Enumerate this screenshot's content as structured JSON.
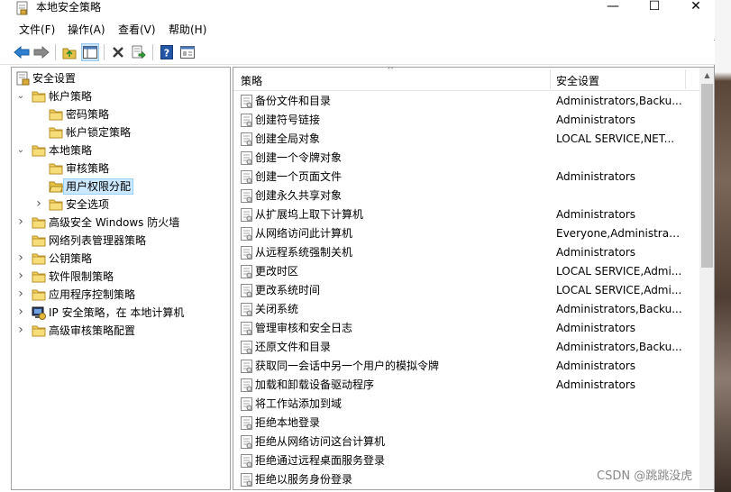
{
  "window": {
    "title": "本地安全策略",
    "minimize_glyph": "—",
    "maximize_glyph": "☐",
    "close_glyph": "✕"
  },
  "menu": [
    "文件(F)",
    "操作(A)",
    "查看(V)",
    "帮助(H)"
  ],
  "toolbar": {
    "buttons": [
      "back-arrow-icon",
      "forward-arrow-icon",
      "up-folder-icon",
      "show-hide-tree-icon",
      "delete-icon",
      "export-list-icon",
      "help-icon",
      "properties-icon"
    ]
  },
  "tree": {
    "items": [
      {
        "label": "安全设置",
        "level": 0,
        "expander": "",
        "icon": "security-settings-icon"
      },
      {
        "label": "帐户策略",
        "level": 1,
        "expander": "expanded",
        "icon": "folder-icon"
      },
      {
        "label": "密码策略",
        "level": 2,
        "expander": "",
        "icon": "folder-icon"
      },
      {
        "label": "帐户锁定策略",
        "level": 2,
        "expander": "",
        "icon": "folder-icon"
      },
      {
        "label": "本地策略",
        "level": 1,
        "expander": "expanded",
        "icon": "folder-icon"
      },
      {
        "label": "审核策略",
        "level": 2,
        "expander": "",
        "icon": "folder-icon"
      },
      {
        "label": "用户权限分配",
        "level": 2,
        "expander": "",
        "icon": "open-folder-icon",
        "selected": true
      },
      {
        "label": "安全选项",
        "level": 2,
        "expander": "collapsed",
        "icon": "folder-icon"
      },
      {
        "label": "高级安全 Windows 防火墙",
        "level": 1,
        "expander": "collapsed",
        "icon": "folder-icon"
      },
      {
        "label": "网络列表管理器策略",
        "level": 1,
        "expander": "",
        "icon": "folder-icon"
      },
      {
        "label": "公钥策略",
        "level": 1,
        "expander": "collapsed",
        "icon": "folder-icon"
      },
      {
        "label": "软件限制策略",
        "level": 1,
        "expander": "collapsed",
        "icon": "folder-icon"
      },
      {
        "label": "应用程序控制策略",
        "level": 1,
        "expander": "collapsed",
        "icon": "folder-icon"
      },
      {
        "label": "IP 安全策略，在 本地计算机",
        "level": 1,
        "expander": "collapsed",
        "icon": "ip-security-icon"
      },
      {
        "label": "高级审核策略配置",
        "level": 1,
        "expander": "collapsed",
        "icon": "folder-icon"
      }
    ]
  },
  "list": {
    "columns": [
      "策略",
      "安全设置"
    ],
    "sort_glyph": "^",
    "rows": [
      {
        "policy": "备份文件和目录",
        "setting": "Administrators,Backu..."
      },
      {
        "policy": "创建符号链接",
        "setting": "Administrators"
      },
      {
        "policy": "创建全局对象",
        "setting": "LOCAL SERVICE,NET..."
      },
      {
        "policy": "创建一个令牌对象",
        "setting": ""
      },
      {
        "policy": "创建一个页面文件",
        "setting": "Administrators"
      },
      {
        "policy": "创建永久共享对象",
        "setting": ""
      },
      {
        "policy": "从扩展坞上取下计算机",
        "setting": "Administrators"
      },
      {
        "policy": "从网络访问此计算机",
        "setting": "Everyone,Administrat..."
      },
      {
        "policy": "从远程系统强制关机",
        "setting": "Administrators"
      },
      {
        "policy": "更改时区",
        "setting": "LOCAL SERVICE,Admi..."
      },
      {
        "policy": "更改系统时间",
        "setting": "LOCAL SERVICE,Admi..."
      },
      {
        "policy": "关闭系统",
        "setting": "Administrators,Backu..."
      },
      {
        "policy": "管理审核和安全日志",
        "setting": "Administrators"
      },
      {
        "policy": "还原文件和目录",
        "setting": "Administrators,Backu..."
      },
      {
        "policy": "获取同一会话中另一个用户的模拟令牌",
        "setting": "Administrators"
      },
      {
        "policy": "加载和卸载设备驱动程序",
        "setting": "Administrators"
      },
      {
        "policy": "将工作站添加到域",
        "setting": ""
      },
      {
        "policy": "拒绝本地登录",
        "setting": ""
      },
      {
        "policy": "拒绝从网络访问这台计算机",
        "setting": ""
      },
      {
        "policy": "拒绝通过远程桌面服务登录",
        "setting": ""
      },
      {
        "policy": "拒绝以服务身份登录",
        "setting": ""
      }
    ]
  },
  "scrollbar": {
    "up_glyph": "▲"
  },
  "watermark": "CSDN @跳跳没虎"
}
